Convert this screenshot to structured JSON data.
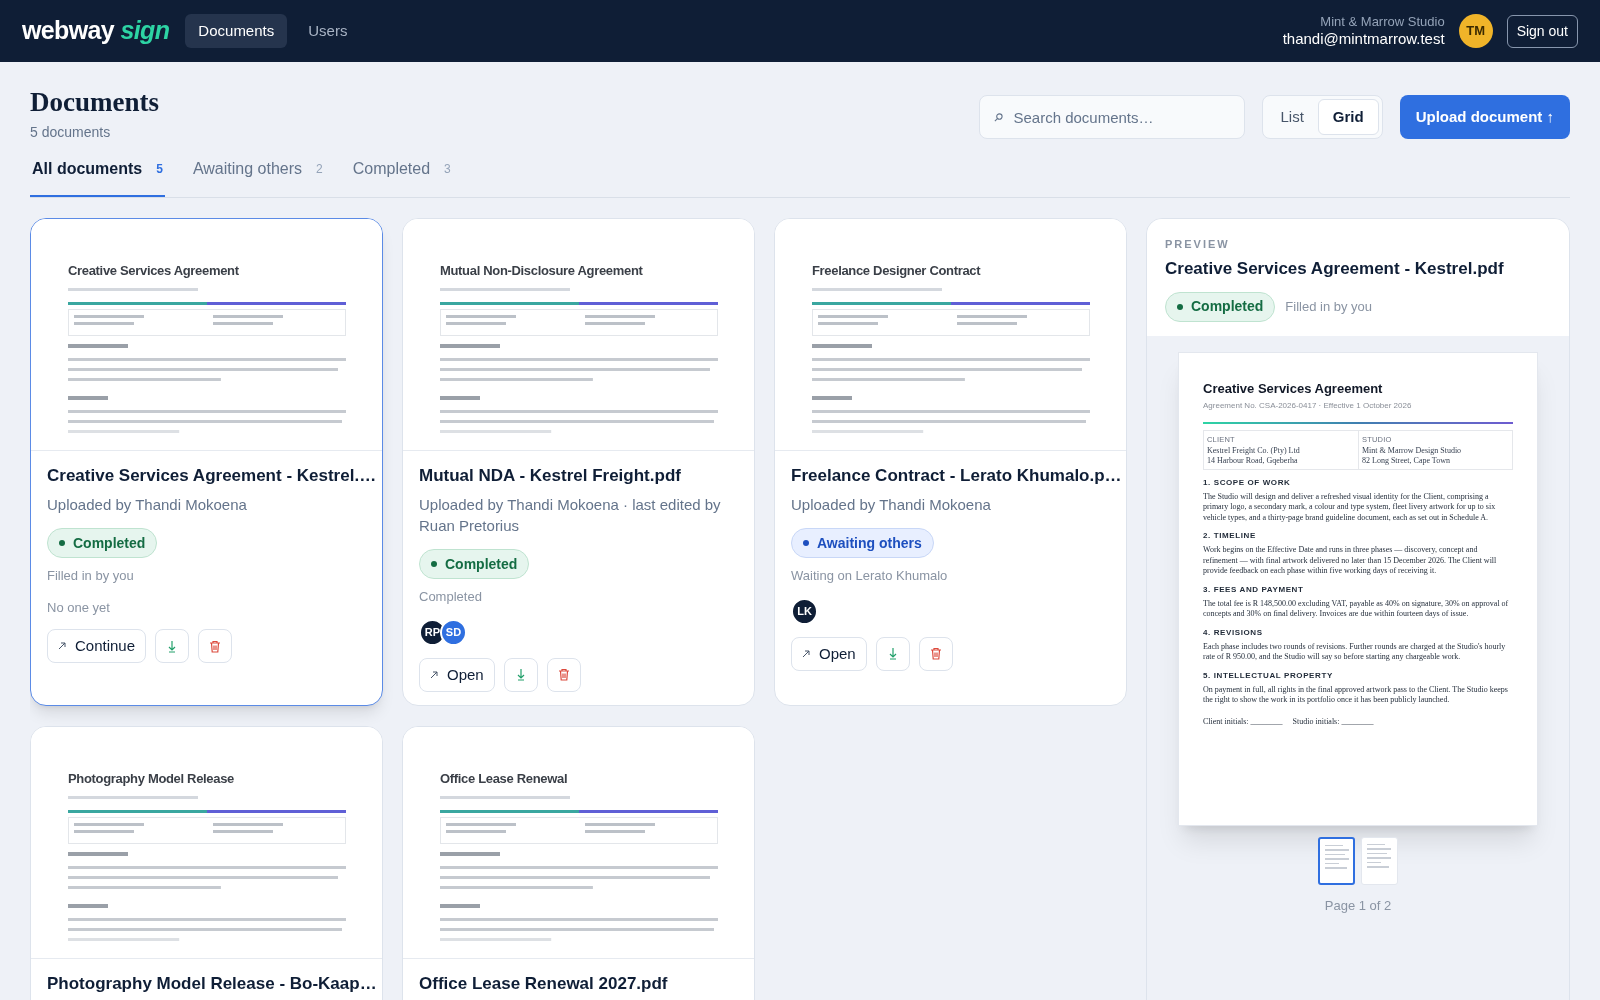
{
  "nav": {
    "logo_word": "webway",
    "logo_accent": "sign",
    "items": [
      {
        "label": "Documents",
        "selected": true
      },
      {
        "label": "Users",
        "selected": false
      }
    ]
  },
  "account": {
    "org": "Mint & Marrow Studio",
    "email": "thandi@mintmarrow.test",
    "initials": "TM",
    "sign_out": "Sign out"
  },
  "page": {
    "title": "Documents",
    "count": "5 documents"
  },
  "search": {
    "placeholder": "Search documents…"
  },
  "view_toggle": [
    {
      "label": "List",
      "selected": false
    },
    {
      "label": "Grid",
      "selected": true
    }
  ],
  "upload_button": "Upload document ↑",
  "tabs": [
    {
      "label": "All documents",
      "count": "5",
      "selected": true
    },
    {
      "label": "Awaiting others",
      "count": "2",
      "selected": false
    },
    {
      "label": "Completed",
      "count": "3",
      "selected": false
    }
  ],
  "cards": [
    {
      "thumb_title": "Creative Services Agreement",
      "title": "Creative Services Agreement - Kestrel.…",
      "uploaded": "Uploaded by Thandi Mokoena",
      "status": {
        "kind": "completed",
        "label": "Completed"
      },
      "note": "Filled in by you",
      "extra": "No one yet",
      "action": "Continue",
      "selected": true
    },
    {
      "thumb_title": "Mutual Non-Disclosure Agreement",
      "title": "Mutual NDA - Kestrel Freight.pdf",
      "uploaded": "Uploaded by Thandi Mokoena · last edited by Ruan Pretorius",
      "status": {
        "kind": "completed",
        "label": "Completed"
      },
      "note": "Completed",
      "avatars": [
        {
          "initials": "RP",
          "color": "#0f1e36"
        },
        {
          "initials": "SD",
          "color": "#2f6fe0"
        }
      ],
      "action": "Open",
      "selected": false
    },
    {
      "thumb_title": "Freelance Designer Contract",
      "title": "Freelance Contract - Lerato Khumalo.p…",
      "uploaded": "Uploaded by Thandi Mokoena",
      "status": {
        "kind": "awaiting",
        "label": "Awaiting others"
      },
      "note": "Waiting on Lerato Khumalo",
      "avatars": [
        {
          "initials": "LK",
          "color": "#0f1e36"
        }
      ],
      "action": "Open",
      "selected": false
    },
    {
      "thumb_title": "Photography Model Release",
      "title": "Photography Model Release - Bo-Kaap…",
      "selected": false
    },
    {
      "thumb_title": "Office Lease Renewal",
      "title": "Office Lease Renewal 2027.pdf",
      "selected": false
    }
  ],
  "preview": {
    "label": "PREVIEW",
    "title": "Creative Services Agreement - Kestrel.pdf",
    "status": {
      "kind": "completed",
      "label": "Completed"
    },
    "note": "Filled in by you",
    "doc": {
      "title": "Creative Services Agreement",
      "meta": "Agreement No. CSA-2026-0417 · Effective 1 October 2026",
      "parties": [
        {
          "label": "CLIENT",
          "lines": [
            "Kestrel Freight Co. (Pty) Ltd",
            "14 Harbour Road, Gqeberha"
          ]
        },
        {
          "label": "STUDIO",
          "lines": [
            "Mint & Marrow Design Studio",
            "82 Long Street, Cape Town"
          ]
        }
      ],
      "sections": [
        {
          "heading": "1. SCOPE OF WORK",
          "body": "The Studio will design and deliver a refreshed visual identity for the Client, comprising a primary logo, a secondary mark, a colour and type system, fleet livery artwork for up to six vehicle types, and a thirty-page brand guideline document, each as set out in Schedule A."
        },
        {
          "heading": "2. TIMELINE",
          "body": "Work begins on the Effective Date and runs in three phases — discovery, concept and refinement — with final artwork delivered no later than 15 December 2026. The Client will provide feedback on each phase within five working days of receiving it."
        },
        {
          "heading": "3. FEES AND PAYMENT",
          "body": "The total fee is R 148,500.00 excluding VAT, payable as 40% on signature, 30% on approval of concepts and 30% on final delivery. Invoices are due within fourteen days of issue."
        },
        {
          "heading": "4. REVISIONS",
          "body": "Each phase includes two rounds of revisions. Further rounds are charged at the Studio's hourly rate of R 950.00, and the Studio will say so before starting any chargeable work."
        },
        {
          "heading": "5. INTELLECTUAL PROPERTY",
          "body": "On payment in full, all rights in the final approved artwork pass to the Client. The Studio keeps the right to show the work in its portfolio once it has been publicly launched."
        }
      ],
      "initials": [
        "Client initials: ________",
        "Studio initials: ________"
      ]
    },
    "pages": [
      {
        "selected": true
      },
      {
        "selected": false
      }
    ],
    "page_label": "Page 1 of 2"
  }
}
